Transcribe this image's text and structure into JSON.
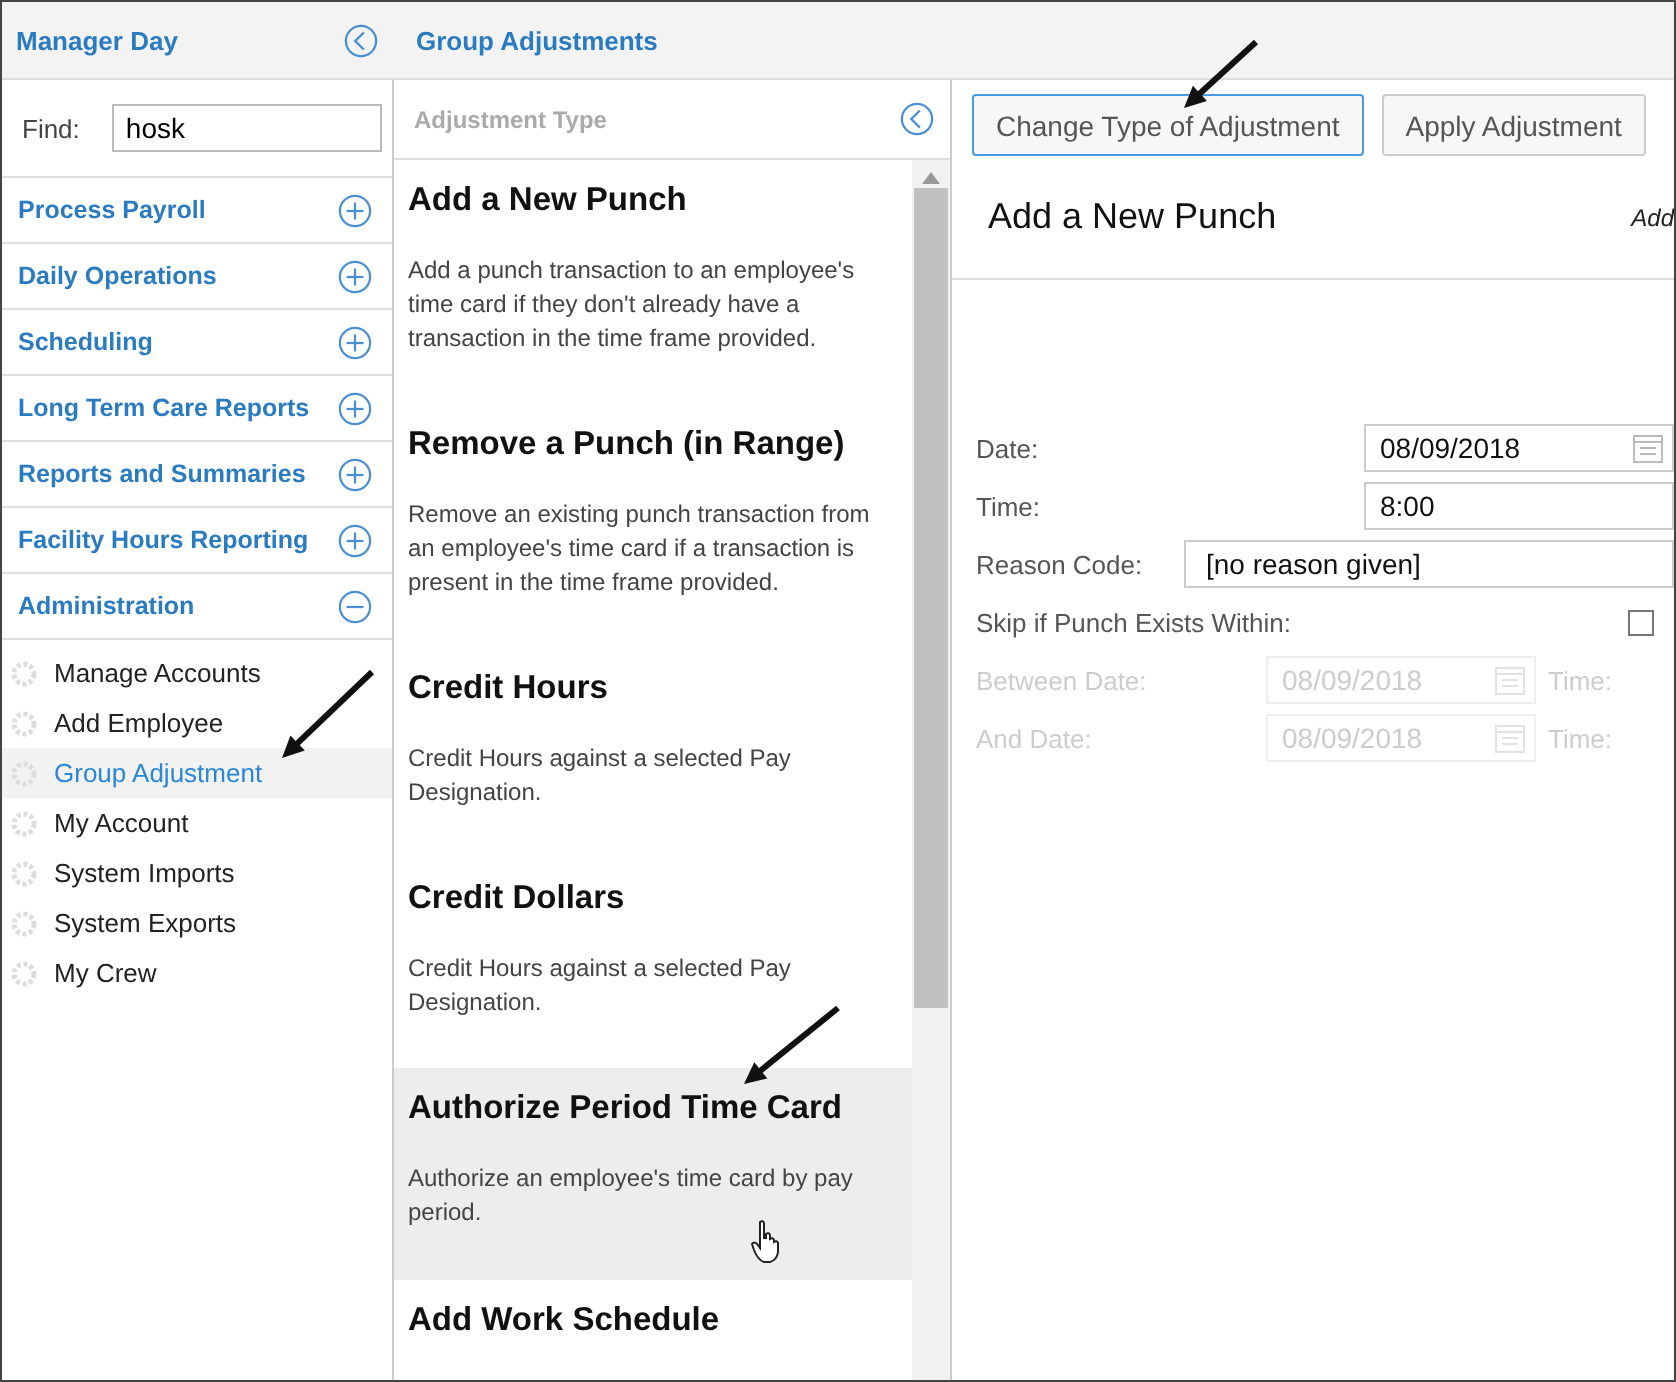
{
  "sidebar": {
    "title": "Manager Day",
    "find_label": "Find:",
    "find_value": "hosk",
    "sections": [
      {
        "label": "Process Payroll",
        "expanded": false
      },
      {
        "label": "Daily Operations",
        "expanded": false
      },
      {
        "label": "Scheduling",
        "expanded": false
      },
      {
        "label": "Long Term Care Reports",
        "expanded": false
      },
      {
        "label": "Reports and Summaries",
        "expanded": false
      },
      {
        "label": "Facility Hours Reporting",
        "expanded": false
      },
      {
        "label": "Administration",
        "expanded": true
      }
    ],
    "items": [
      {
        "label": "Manage Accounts",
        "selected": false
      },
      {
        "label": "Add Employee",
        "selected": false
      },
      {
        "label": "Group Adjustment",
        "selected": true
      },
      {
        "label": "My Account",
        "selected": false
      },
      {
        "label": "System Imports",
        "selected": false
      },
      {
        "label": "System Exports",
        "selected": false
      },
      {
        "label": "My Crew",
        "selected": false
      }
    ]
  },
  "page_title": "Group Adjustments",
  "adjustment_types": {
    "heading": "Adjustment Type",
    "items": [
      {
        "title": "Add a New Punch",
        "description": "Add a punch transaction to an employee's time card if they don't already have a transaction in the time frame provided.",
        "hovered": false
      },
      {
        "title": "Remove a Punch (in Range)",
        "description": "Remove an existing punch transaction from an employee's time card if a transaction is present in the time frame provided.",
        "hovered": false
      },
      {
        "title": "Credit Hours",
        "description": "Credit Hours against a selected Pay Designation.",
        "hovered": false
      },
      {
        "title": "Credit Dollars",
        "description": "Credit Hours against a selected Pay Designation.",
        "hovered": false
      },
      {
        "title": "Authorize Period Time Card",
        "description": "Authorize an employee's time card by pay period.",
        "hovered": true
      },
      {
        "title": "Add Work Schedule",
        "hovered": false
      }
    ]
  },
  "buttons": [
    {
      "label": "Change Type of Adjustment",
      "focused": true
    },
    {
      "label": "Apply Adjustment",
      "focused": false
    }
  ],
  "form": {
    "title": "Add a New Punch",
    "side_text": "Add",
    "fields": [
      {
        "kind": "date",
        "label": "Date:",
        "value": "08/09/2018",
        "disabled": false
      },
      {
        "kind": "text",
        "label": "Time:",
        "value": "8:00",
        "disabled": false
      },
      {
        "kind": "select",
        "label": "Reason Code:",
        "value": "[no reason given]",
        "disabled": false
      },
      {
        "kind": "checkbox",
        "label": "Skip if Punch Exists Within:",
        "checked": false,
        "disabled": false
      },
      {
        "kind": "range",
        "label": "Between Date:",
        "value": "08/09/2018",
        "time_label": "Time:",
        "disabled": true
      },
      {
        "kind": "range",
        "label": "And Date:",
        "value": "08/09/2018",
        "time_label": "Time:",
        "disabled": true
      }
    ]
  }
}
